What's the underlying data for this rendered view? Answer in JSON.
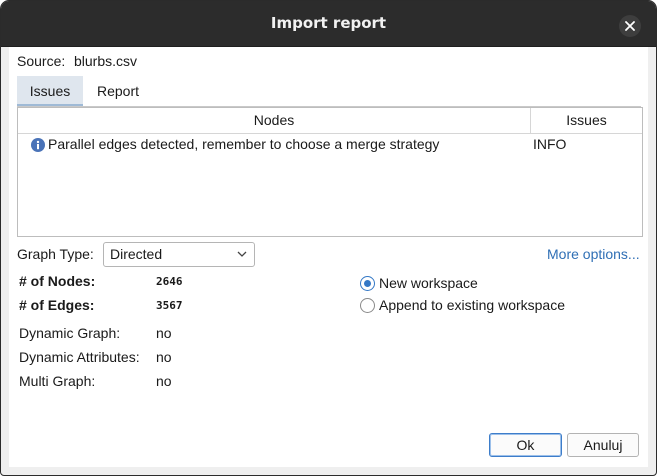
{
  "window": {
    "title": "Import report"
  },
  "source": {
    "label": "Source:",
    "file": "blurbs.csv"
  },
  "tabs": [
    {
      "label": "Issues"
    },
    {
      "label": "Report"
    }
  ],
  "issues_table": {
    "columns": [
      "Nodes",
      "Issues"
    ],
    "rows": [
      {
        "message": "Parallel edges detected, remember to choose a merge strategy",
        "level": "INFO"
      }
    ]
  },
  "graph_type": {
    "label": "Graph Type:",
    "value": "Directed"
  },
  "more_options": "More options...",
  "stats": {
    "nodes_label": "# of Nodes:",
    "nodes_value": "2646",
    "edges_label": "# of Edges:",
    "edges_value": "3567",
    "dynamic_graph_label": "Dynamic Graph:",
    "dynamic_graph_value": "no",
    "dynamic_attributes_label": "Dynamic Attributes:",
    "dynamic_attributes_value": "no",
    "multi_graph_label": "Multi Graph:",
    "multi_graph_value": "no"
  },
  "workspace": {
    "new_label": "New workspace",
    "append_label": "Append to existing workspace",
    "selected": "new"
  },
  "buttons": {
    "ok": "Ok",
    "cancel": "Anuluj"
  },
  "colors": {
    "titlebar": "#2c2c2c",
    "accent": "#3478c6",
    "link": "#2f6fb5"
  }
}
